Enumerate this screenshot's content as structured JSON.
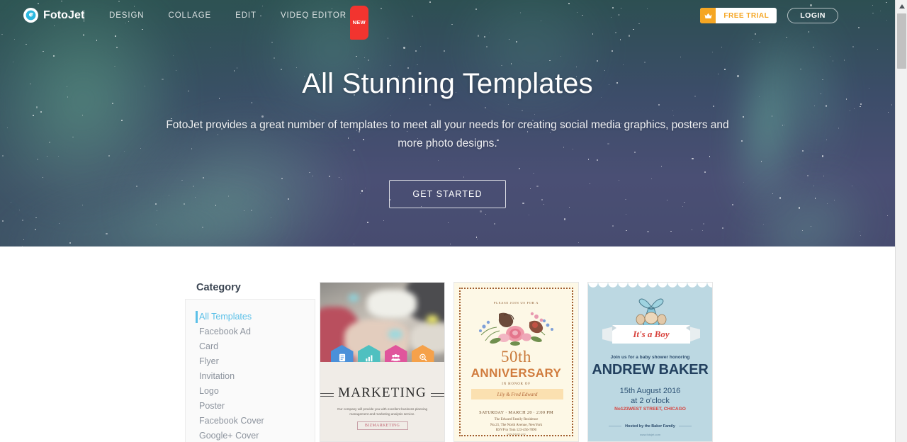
{
  "header": {
    "brand": "FotoJet",
    "logo_icon": "fotojet-spiral-icon",
    "nav": [
      {
        "label": "DESIGN",
        "badge": null
      },
      {
        "label": "COLLAGE",
        "badge": null
      },
      {
        "label": "EDIT",
        "badge": null
      },
      {
        "label": "VIDEO EDITOR",
        "badge": "NEW"
      }
    ],
    "free_trial_label": "FREE TRIAL",
    "crown_icon": "crown-icon",
    "login_label": "LOGIN",
    "accent_orange": "#f5a623",
    "badge_red": "#f2342f"
  },
  "hero": {
    "title": "All Stunning Templates",
    "subtitle": "FotoJet provides a great number of templates to meet all your needs for creating social media graphics, posters and more photo designs.",
    "cta_label": "GET STARTED",
    "background": "aurora-night-sky"
  },
  "sidebar": {
    "heading": "Category",
    "active_color": "#5bc0e8",
    "items": [
      {
        "label": "All Templates",
        "active": true
      },
      {
        "label": "Facebook Ad",
        "active": false
      },
      {
        "label": "Card",
        "active": false
      },
      {
        "label": "Flyer",
        "active": false
      },
      {
        "label": "Invitation",
        "active": false
      },
      {
        "label": "Logo",
        "active": false
      },
      {
        "label": "Poster",
        "active": false
      },
      {
        "label": "Facebook Cover",
        "active": false
      },
      {
        "label": "Google+ Cover",
        "active": false
      }
    ]
  },
  "templates": [
    {
      "name": "marketing-flyer",
      "title": "MARKETING",
      "description": "Our company will provide you with excellent business planning management and marketing analysis service.",
      "button_label": "BIZMARKETING",
      "icons": [
        {
          "name": "clipboard-icon",
          "glyph": "✎",
          "color": "#4a90d9"
        },
        {
          "name": "bar-chart-icon",
          "glyph": "ὌA",
          "color": "#4fc0c0"
        },
        {
          "name": "people-icon",
          "glyph": "὆5",
          "color": "#e0559c"
        },
        {
          "name": "search-target-icon",
          "glyph": "ὐD",
          "color": "#f5a14a"
        }
      ]
    },
    {
      "name": "anniversary-invitation",
      "join_line": "PLEASE JOIN US FOR A",
      "number": "50th",
      "word": "ANNIVERSARY",
      "honor_line": "IN HONOR OF",
      "names": "Lily & Fred Edward",
      "when": "SATURDAY  ·  MARCH 20  ·  2:00 PM",
      "where": "The Edward Family Residence\nNo.21, The North Avenue, NewYork\nRSVP to Tom 123-456-7890",
      "url": "www.fotojet.com"
    },
    {
      "name": "baby-shower-invitation",
      "banner": "It's a Boy",
      "join_line": "Join us for a baby shower honoring",
      "name_line": "ANDREW BAKER",
      "date_line": "15th  August 2016",
      "time_line": "at 2 o'clock",
      "address": "No123WEST STREET, CHICAGO",
      "host": "Hosted by the Baker Family",
      "url": "www.fotojet.com"
    }
  ],
  "scrollbar": {
    "up_arrow_icon": "chevron-up-icon"
  }
}
